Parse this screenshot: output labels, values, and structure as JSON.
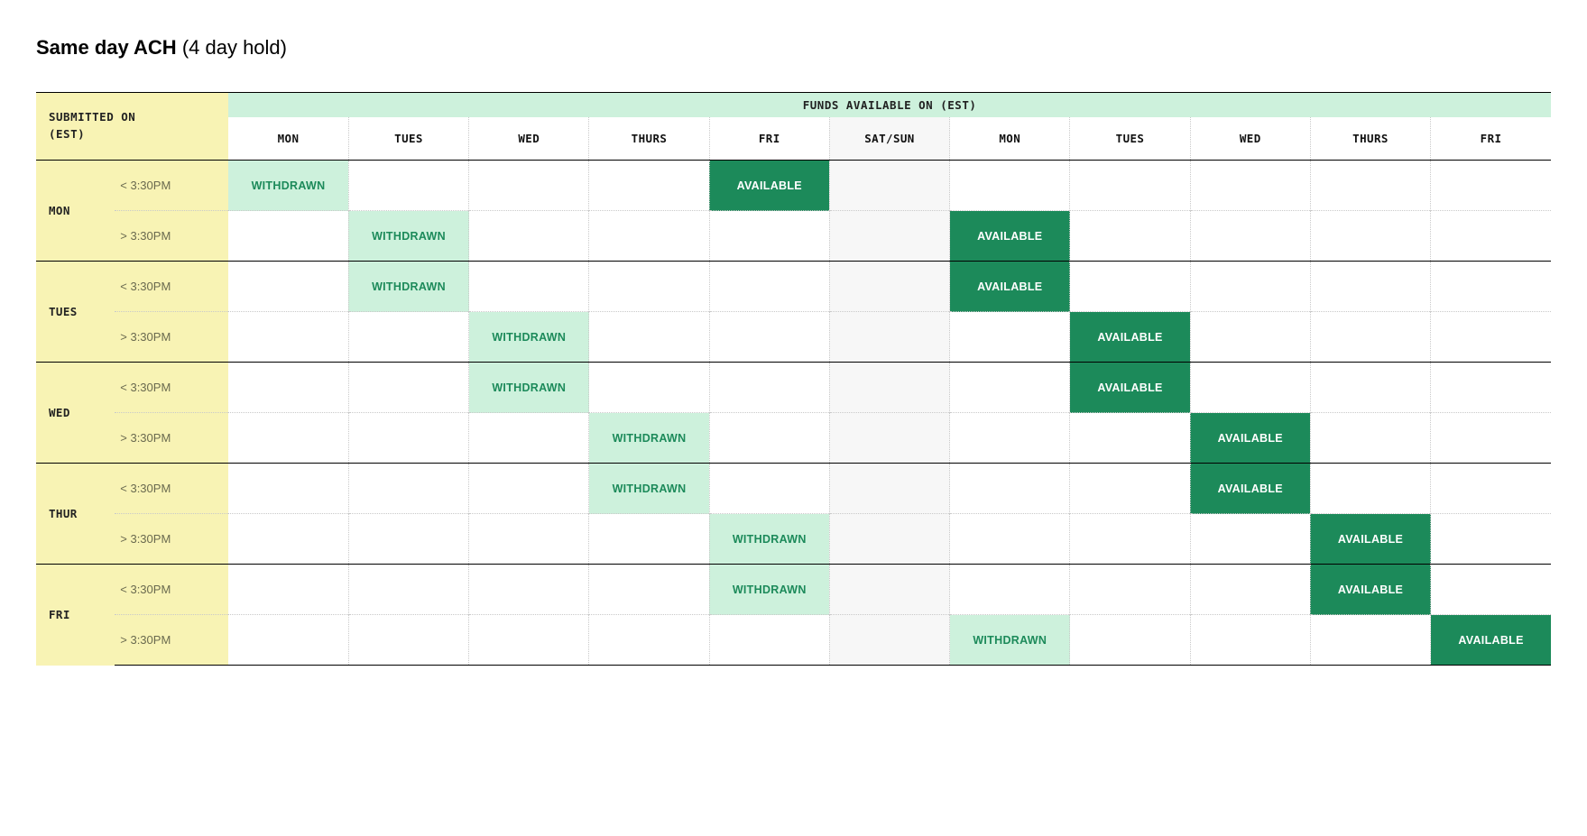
{
  "title": {
    "bold": "Same day ACH",
    "light": "(4 day hold)"
  },
  "headers": {
    "submitted_on_l1": "SUBMITTED ON",
    "submitted_on_l2": "(EST)",
    "funds_available": "FUNDS AVAILABLE ON (EST)",
    "columns": [
      "MON",
      "TUES",
      "WED",
      "THURS",
      "FRI",
      "SAT/SUN",
      "MON",
      "TUES",
      "WED",
      "THURS",
      "FRI"
    ]
  },
  "labels": {
    "withdrawn": "WITHDRAWN",
    "available": "AVAILABLE"
  },
  "row_headers": {
    "days": [
      "MON",
      "TUES",
      "WED",
      "THUR",
      "FRI"
    ],
    "times": [
      "< 3:30PM",
      "> 3:30PM"
    ]
  },
  "chart_data": {
    "type": "table",
    "title": "Same day ACH (4 day hold)",
    "xlabel": "FUNDS AVAILABLE ON (EST)",
    "ylabel": "SUBMITTED ON (EST)",
    "columns": [
      "MON",
      "TUES",
      "WED",
      "THURS",
      "FRI",
      "SAT/SUN",
      "MON",
      "TUES",
      "WED",
      "THURS",
      "FRI"
    ],
    "rows": [
      {
        "day": "MON",
        "time": "< 3:30PM",
        "cells": [
          "WITHDRAWN",
          "",
          "",
          "",
          "AVAILABLE",
          "",
          "",
          "",
          "",
          "",
          ""
        ]
      },
      {
        "day": "MON",
        "time": "> 3:30PM",
        "cells": [
          "",
          "WITHDRAWN",
          "",
          "",
          "",
          "",
          "AVAILABLE",
          "",
          "",
          "",
          ""
        ]
      },
      {
        "day": "TUES",
        "time": "< 3:30PM",
        "cells": [
          "",
          "WITHDRAWN",
          "",
          "",
          "",
          "",
          "AVAILABLE",
          "",
          "",
          "",
          ""
        ]
      },
      {
        "day": "TUES",
        "time": "> 3:30PM",
        "cells": [
          "",
          "",
          "WITHDRAWN",
          "",
          "",
          "",
          "",
          "AVAILABLE",
          "",
          "",
          ""
        ]
      },
      {
        "day": "WED",
        "time": "< 3:30PM",
        "cells": [
          "",
          "",
          "WITHDRAWN",
          "",
          "",
          "",
          "",
          "AVAILABLE",
          "",
          "",
          ""
        ]
      },
      {
        "day": "WED",
        "time": "> 3:30PM",
        "cells": [
          "",
          "",
          "",
          "WITHDRAWN",
          "",
          "",
          "",
          "",
          "AVAILABLE",
          "",
          ""
        ]
      },
      {
        "day": "THUR",
        "time": "< 3:30PM",
        "cells": [
          "",
          "",
          "",
          "WITHDRAWN",
          "",
          "",
          "",
          "",
          "AVAILABLE",
          "",
          ""
        ]
      },
      {
        "day": "THUR",
        "time": "> 3:30PM",
        "cells": [
          "",
          "",
          "",
          "",
          "WITHDRAWN",
          "",
          "",
          "",
          "",
          "AVAILABLE",
          ""
        ]
      },
      {
        "day": "FRI",
        "time": "< 3:30PM",
        "cells": [
          "",
          "",
          "",
          "",
          "WITHDRAWN",
          "",
          "",
          "",
          "",
          "AVAILABLE",
          ""
        ]
      },
      {
        "day": "FRI",
        "time": "> 3:30PM",
        "cells": [
          "",
          "",
          "",
          "",
          "",
          "",
          "WITHDRAWN",
          "",
          "",
          "",
          "AVAILABLE"
        ]
      }
    ]
  }
}
